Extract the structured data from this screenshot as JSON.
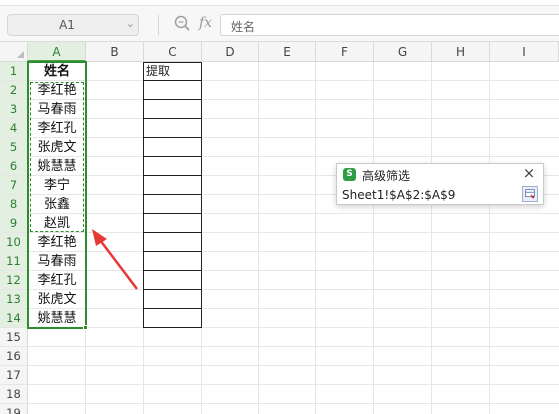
{
  "formula_bar": {
    "cell_ref": "A1",
    "formula": "姓名",
    "icons": [
      "dropdown-arrow-icon",
      "zoom-icon",
      "fx-icon"
    ]
  },
  "sheet": {
    "columns": [
      "A",
      "B",
      "C",
      "D",
      "E",
      "F",
      "G",
      "H",
      "I"
    ],
    "rows": [
      "1",
      "2",
      "3",
      "4",
      "5",
      "6",
      "7",
      "8",
      "9",
      "10",
      "11",
      "12",
      "13",
      "14",
      "15",
      "16",
      "17",
      "18",
      "19"
    ],
    "column_a": [
      "姓名",
      "李红艳",
      "马春雨",
      "李红孔",
      "张虎文",
      "姚慧慧",
      "李宁",
      "张鑫",
      "赵凯",
      "李红艳",
      "马春雨",
      "李红孔",
      "张虎文",
      "姚慧慧"
    ],
    "c1": "提取"
  },
  "advanced_filter_dialog": {
    "title": "高级筛选",
    "range_value": "Sheet1!$A$2:$A$9",
    "close_symbol": "×",
    "logo_letter": "S"
  },
  "colors": {
    "selection_green": "#2e8b2e",
    "arrow_red": "#e53935",
    "header_bg": "#f5f5f5"
  }
}
